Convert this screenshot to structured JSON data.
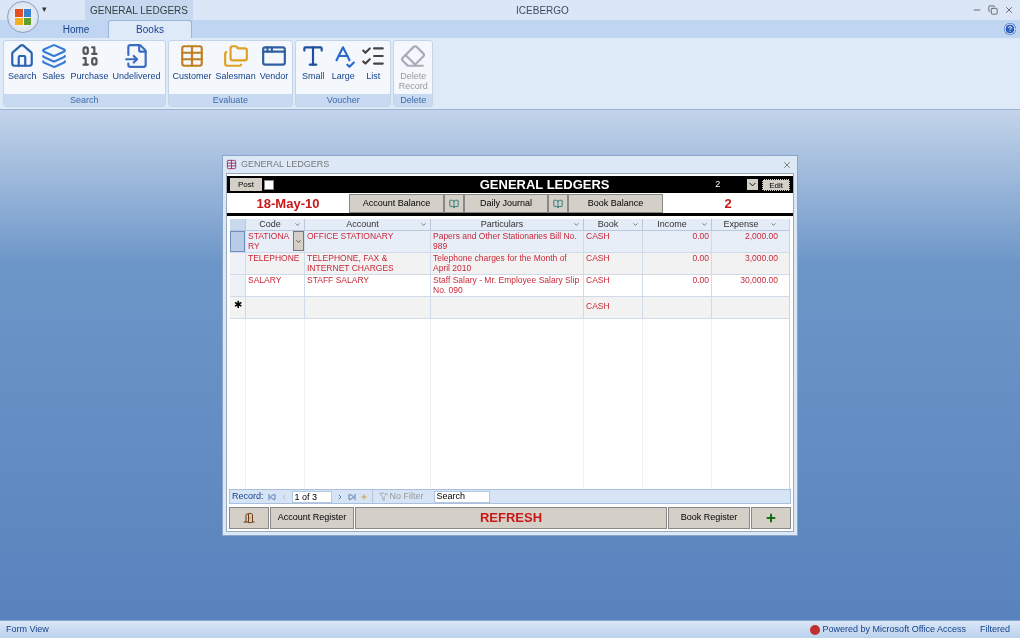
{
  "window": {
    "title": "ICEBERGO",
    "contextual_tab": "GENERAL LEDGERS",
    "quick_access": "▾"
  },
  "tabs": [
    {
      "label": "Home",
      "selected": false
    },
    {
      "label": "Books",
      "selected": true
    }
  ],
  "ribbon": [
    {
      "label": "Search",
      "buttons": [
        {
          "label": "Search",
          "disabled": false
        },
        {
          "label": "Sales",
          "disabled": false
        },
        {
          "label": "Purchase",
          "disabled": false
        },
        {
          "label": "Undelivered",
          "disabled": false
        }
      ]
    },
    {
      "label": "Evaluate",
      "buttons": [
        {
          "label": "Customer",
          "disabled": false
        },
        {
          "label": "Salesman",
          "disabled": false
        },
        {
          "label": "Vendor",
          "disabled": false
        }
      ]
    },
    {
      "label": "Voucher",
      "buttons": [
        {
          "label": "Small",
          "disabled": false
        },
        {
          "label": "Large",
          "disabled": false
        },
        {
          "label": "List",
          "disabled": false
        }
      ]
    },
    {
      "label": "Delete",
      "buttons": [
        {
          "label": "Delete Record",
          "disabled": true
        }
      ]
    }
  ],
  "form": {
    "title": "GENERAL LEDGERS",
    "post_label": "Post",
    "post_checked": false,
    "heading": "GENERAL LEDGERS",
    "count": "2",
    "edit_label": "Edit",
    "date": "18-May-10",
    "toolbar": [
      "Account Balance",
      "Daily Journal",
      "Book Balance"
    ],
    "balance": "2",
    "columns": [
      "Code",
      "Account",
      "Particulars",
      "Book",
      "Income",
      "Expense"
    ],
    "rows": [
      {
        "current": true,
        "cells": [
          "STATIONARY",
          "OFFICE STATIONARY",
          "Papers and Other Stationaries Bill No. 989",
          "CASH",
          "0.00",
          "2,000.00"
        ]
      },
      {
        "current": false,
        "cells": [
          "TELEPHONE",
          "TELEPHONE, FAX & INTERNET CHARGES",
          "Telephone charges for the Month of April 2010",
          "CASH",
          "0.00",
          "3,000.00"
        ]
      },
      {
        "current": false,
        "cells": [
          "SALARY",
          "STAFF SALARY",
          "Staff Salary - Mr. Employee Salary Slip No. 090",
          "CASH",
          "0.00",
          "30,000.00"
        ]
      }
    ],
    "new_row": {
      "marker": "✱",
      "book": "CASH"
    },
    "navigation": {
      "label": "Record:",
      "position": "1 of 3",
      "filter": "No Filter",
      "placeholder": "Search"
    },
    "footer": {
      "left": "Account Register",
      "center": "REFRESH",
      "right": "Book Register"
    }
  },
  "status_bar": {
    "view": "Form View",
    "powered": "Powered by Microsoft Office Access",
    "filter": "Filtered"
  }
}
